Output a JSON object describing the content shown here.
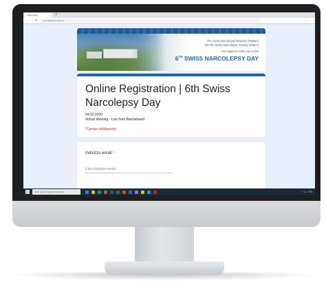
{
  "browser": {
    "tab_title": "Online Regi... ",
    "tab_close": "×",
    "new_tab": "+",
    "nav_buttons": "← → ⟳ ⌂",
    "url": "docs.google.com/forms",
    "tool_icons": "☆ ⋮"
  },
  "banner": {
    "line1": "The Swiss Narcolepsy Network (SNaNe)",
    "line2": "and the Swiss Narcolepsy Society (SNaG)",
    "line3": "Are happy to invite you to the",
    "title_num": "6",
    "title_sup": "TH",
    "title_rest": " SWISS NARCOLEPSY DAY"
  },
  "form": {
    "title": "Online Registration | 6th Swiss Narcolepsy Day",
    "date": "04.02.2020",
    "description": "Virtual Meeting - Live from Barmelweid",
    "required_note": "*Campo obbligatorio",
    "email_label": "Indirizzo email",
    "email_required_star": " *",
    "email_placeholder": "Il tuo indirizzo email"
  },
  "taskbar": {
    "search_placeholder": "Scrivi qui per eseguire la ricerca",
    "tray": "⌃ ▭ ◗ ITA"
  },
  "colors": {
    "accent": "#1f66a8",
    "required": "#d93025",
    "page_bg": "#e8f0fe"
  }
}
